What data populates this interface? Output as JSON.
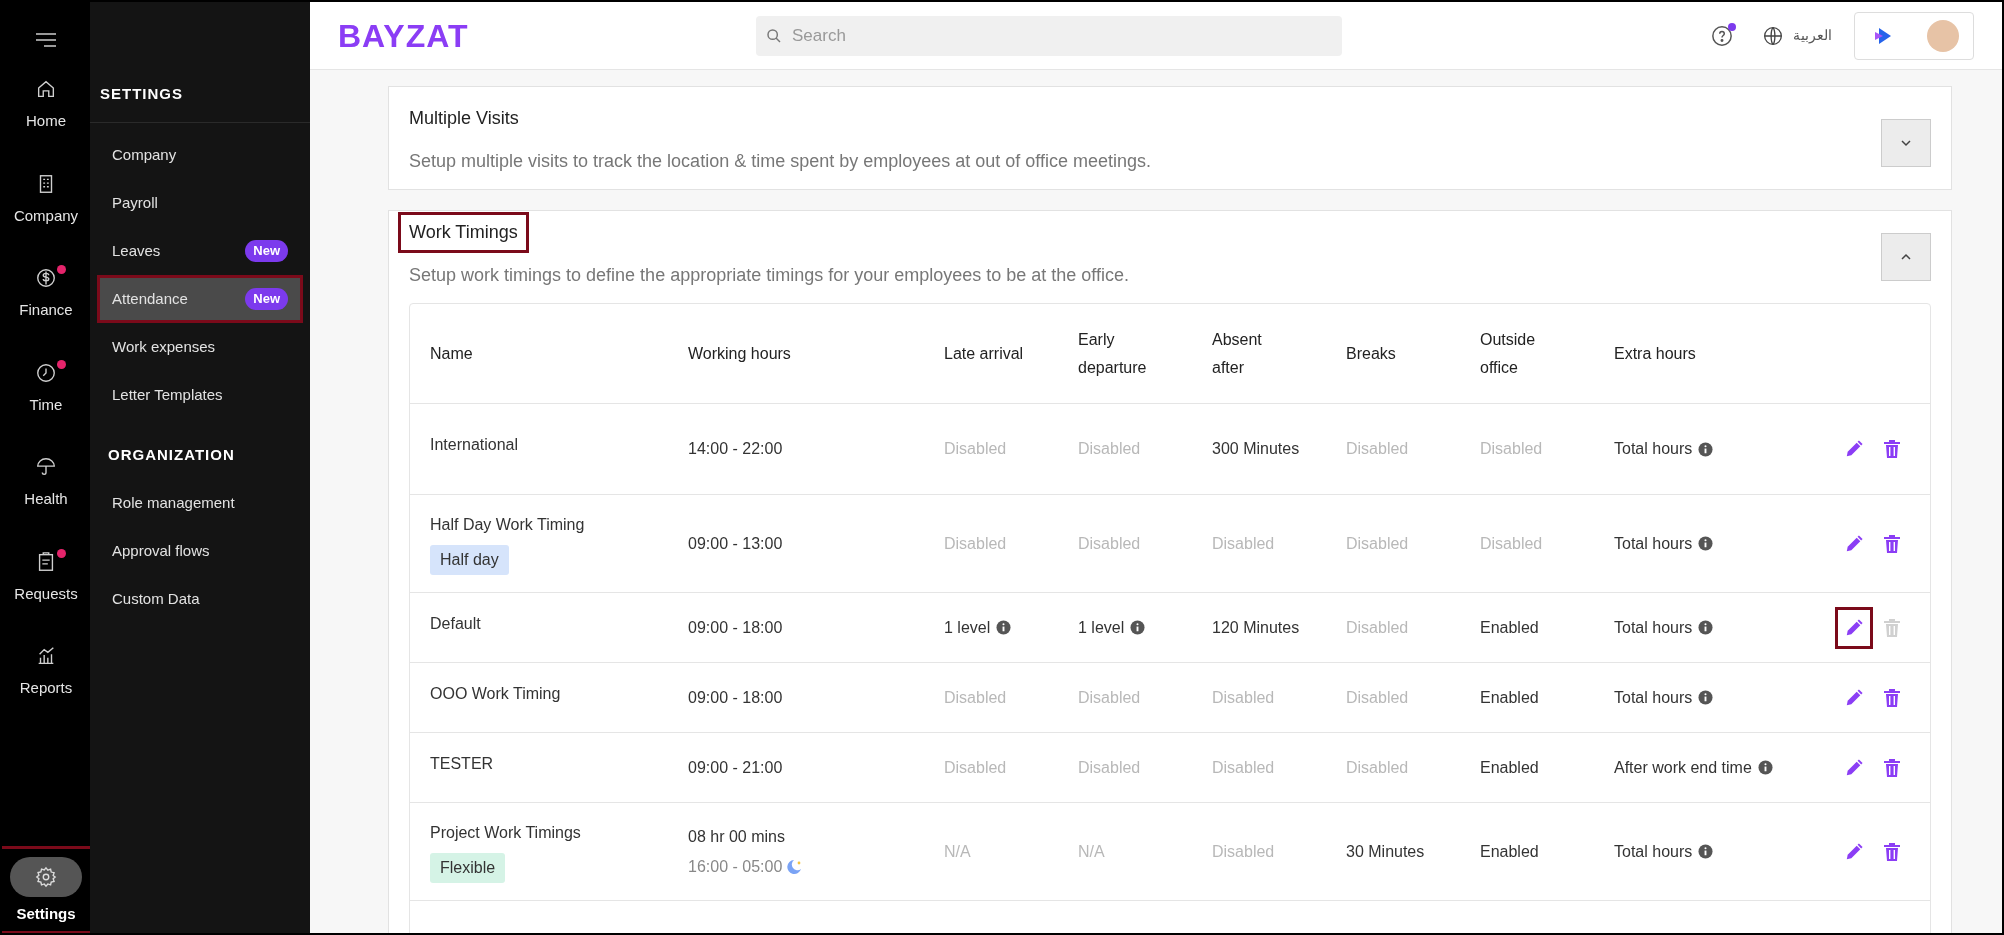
{
  "rail": {
    "items": [
      {
        "label": "Home",
        "dot": false,
        "selected": false
      },
      {
        "label": "Company",
        "dot": false,
        "selected": false
      },
      {
        "label": "Finance",
        "dot": true,
        "selected": false
      },
      {
        "label": "Time",
        "dot": true,
        "selected": false
      },
      {
        "label": "Health",
        "dot": false,
        "selected": false
      },
      {
        "label": "Requests",
        "dot": true,
        "selected": false
      },
      {
        "label": "Reports",
        "dot": false,
        "selected": false
      }
    ],
    "settings": {
      "label": "Settings",
      "selected": true,
      "highlighted": true
    }
  },
  "sidebar": {
    "sections": [
      {
        "title": "SETTINGS",
        "items": [
          {
            "label": "Company",
            "selected": false,
            "highlighted": false
          },
          {
            "label": "Payroll",
            "selected": false,
            "highlighted": false
          },
          {
            "label": "Leaves",
            "badge": "New",
            "selected": false,
            "highlighted": false
          },
          {
            "label": "Attendance",
            "badge": "New",
            "selected": true,
            "highlighted": true
          },
          {
            "label": "Work expenses",
            "selected": false,
            "highlighted": false
          },
          {
            "label": "Letter Templates",
            "selected": false,
            "highlighted": false
          }
        ]
      },
      {
        "title": "ORGANIZATION",
        "items": [
          {
            "label": "Role management",
            "selected": false,
            "highlighted": false
          },
          {
            "label": "Approval flows",
            "selected": false,
            "highlighted": false
          },
          {
            "label": "Custom Data",
            "selected": false,
            "highlighted": false
          }
        ]
      }
    ]
  },
  "header": {
    "logo": "BAYZAT",
    "search": {
      "placeholder": "Search"
    },
    "help_dot": true,
    "language": "العربية"
  },
  "cards": [
    {
      "title": "Multiple Visits",
      "description": "Setup multiple visits to track the location & time spent by employees at out of office meetings.",
      "expanded": false,
      "highlighted": false
    },
    {
      "title": "Work Timings",
      "description": "Setup work timings to define the appropriate timings for your employees to be at the office.",
      "expanded": true,
      "highlighted": true
    }
  ],
  "table": {
    "columns": [
      "Name",
      "Working hours",
      "Late arrival",
      "Early departure",
      "Absent after",
      "Breaks",
      "Outside office",
      "Extra hours"
    ],
    "rows": [
      {
        "cells": [
          {
            "text": "International",
            "kind": "name"
          },
          {
            "text": "14:00 - 22:00",
            "kind": "hours"
          },
          {
            "text": "Disabled",
            "kind": "muted"
          },
          {
            "text": "Disabled",
            "kind": "muted"
          },
          {
            "text": "300 Minutes",
            "kind": "text"
          },
          {
            "text": "Disabled",
            "kind": "muted"
          },
          {
            "text": "Disabled",
            "kind": "muted"
          },
          {
            "text": "Total hours",
            "kind": "info"
          }
        ],
        "edit_highlighted": false,
        "delete_disabled": false
      },
      {
        "cells": [
          {
            "text": "Half Day Work Timing",
            "kind": "name",
            "tag": {
              "text": "Half day",
              "color": "#d6e4fb"
            }
          },
          {
            "text": "09:00 - 13:00",
            "kind": "hours"
          },
          {
            "text": "Disabled",
            "kind": "muted"
          },
          {
            "text": "Disabled",
            "kind": "muted"
          },
          {
            "text": "Disabled",
            "kind": "muted"
          },
          {
            "text": "Disabled",
            "kind": "muted"
          },
          {
            "text": "Disabled",
            "kind": "muted"
          },
          {
            "text": "Total hours",
            "kind": "info"
          }
        ],
        "edit_highlighted": false,
        "delete_disabled": false
      },
      {
        "cells": [
          {
            "text": "Default",
            "kind": "name"
          },
          {
            "text": "09:00 - 18:00",
            "kind": "hours"
          },
          {
            "text": "1 level",
            "kind": "info"
          },
          {
            "text": "1 level",
            "kind": "info"
          },
          {
            "text": "120 Minutes",
            "kind": "text"
          },
          {
            "text": "Disabled",
            "kind": "muted"
          },
          {
            "text": "Enabled",
            "kind": "text"
          },
          {
            "text": "Total hours",
            "kind": "info"
          }
        ],
        "edit_highlighted": true,
        "delete_disabled": true
      },
      {
        "cells": [
          {
            "text": "OOO Work Timing",
            "kind": "name"
          },
          {
            "text": "09:00 - 18:00",
            "kind": "hours"
          },
          {
            "text": "Disabled",
            "kind": "muted"
          },
          {
            "text": "Disabled",
            "kind": "muted"
          },
          {
            "text": "Disabled",
            "kind": "muted"
          },
          {
            "text": "Disabled",
            "kind": "muted"
          },
          {
            "text": "Enabled",
            "kind": "text"
          },
          {
            "text": "Total hours",
            "kind": "info"
          }
        ],
        "edit_highlighted": false,
        "delete_disabled": false
      },
      {
        "cells": [
          {
            "text": "TESTER",
            "kind": "name"
          },
          {
            "text": "09:00 - 21:00",
            "kind": "hours"
          },
          {
            "text": "Disabled",
            "kind": "muted"
          },
          {
            "text": "Disabled",
            "kind": "muted"
          },
          {
            "text": "Disabled",
            "kind": "muted"
          },
          {
            "text": "Disabled",
            "kind": "muted"
          },
          {
            "text": "Enabled",
            "kind": "text"
          },
          {
            "text": "After work end time",
            "kind": "info"
          }
        ],
        "edit_highlighted": false,
        "delete_disabled": false
      },
      {
        "cells": [
          {
            "text": "Project Work Timings",
            "kind": "name",
            "tag": {
              "text": "Flexible",
              "color": "#d5f3e6"
            }
          },
          {
            "text": "08 hr 00 mins",
            "kind": "hours",
            "sub": "16:00 - 05:00",
            "overnight": true
          },
          {
            "text": "N/A",
            "kind": "muted"
          },
          {
            "text": "N/A",
            "kind": "muted"
          },
          {
            "text": "Disabled",
            "kind": "muted"
          },
          {
            "text": "30 Minutes",
            "kind": "text"
          },
          {
            "text": "Enabled",
            "kind": "text"
          },
          {
            "text": "Total hours",
            "kind": "info"
          }
        ],
        "edit_highlighted": false,
        "delete_disabled": false
      }
    ]
  }
}
